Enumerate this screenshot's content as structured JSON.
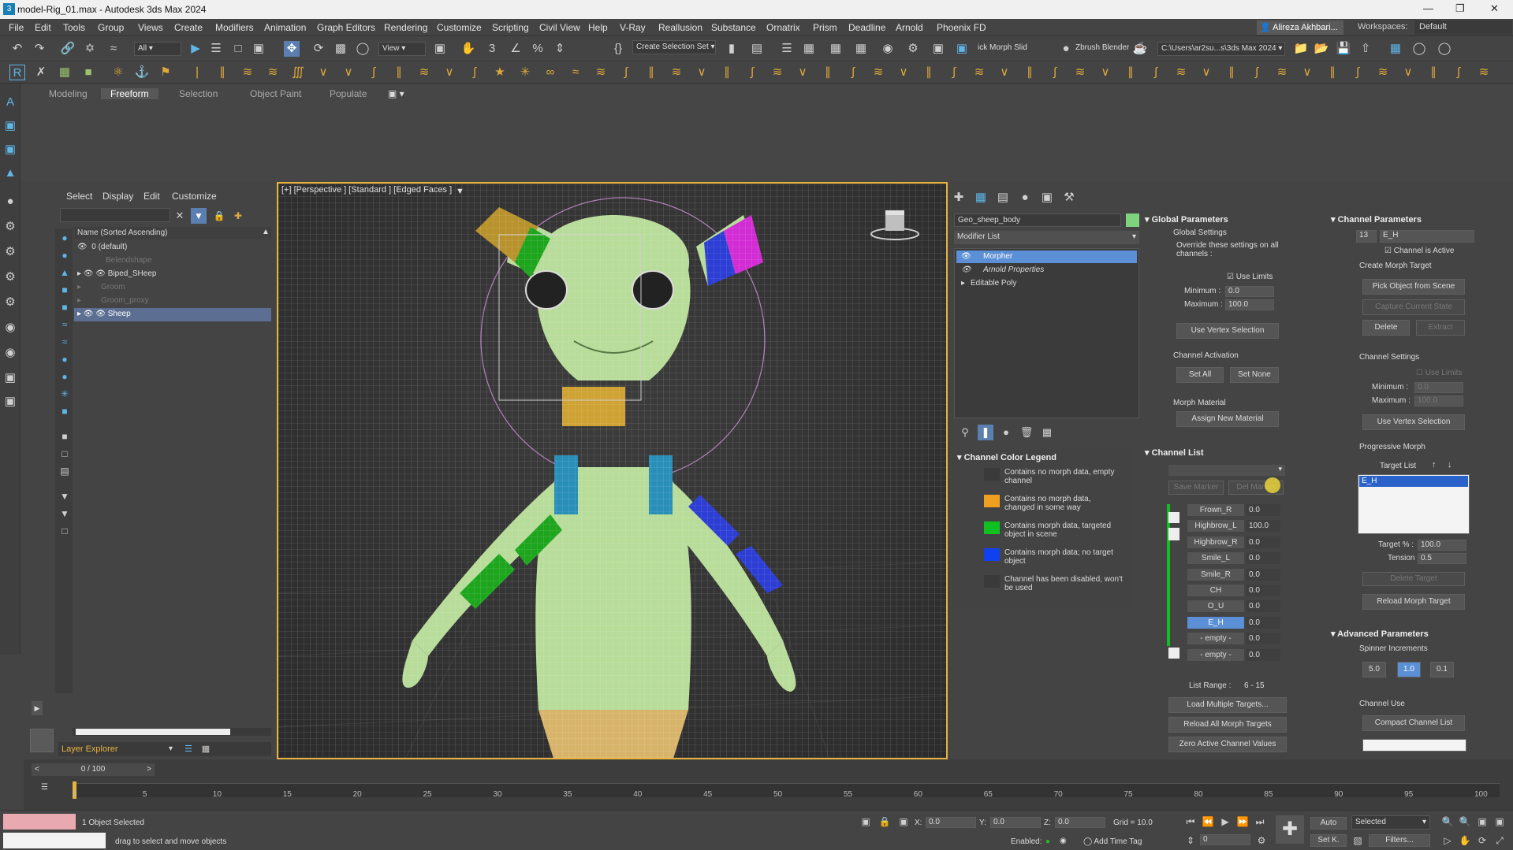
{
  "title": "model-Rig_01.max - Autodesk 3ds Max 2024",
  "menu": [
    "File",
    "Edit",
    "Tools",
    "Group",
    "Views",
    "Create",
    "Modifiers",
    "Animation",
    "Graph Editors",
    "Rendering",
    "Customize",
    "Scripting",
    "Civil View",
    "Help",
    "V-Ray",
    "Reallusion",
    "Substance",
    "Ornatrix",
    "Prism",
    "Deadline",
    "Arnold",
    "Phoenix FD"
  ],
  "user": "Alireza Akhbari...",
  "workspaces_label": "Workspaces:",
  "workspace": "Default",
  "toolbar": {
    "filter": "All",
    "refcoord": "View",
    "selset": "Create Selection Set",
    "morphslider": "ick Morph Slid",
    "zbrush": "Zbrush Blender",
    "path": "C:\\Users\\ar2su...s\\3ds Max 2024"
  },
  "ribbon_tabs": [
    "Modeling",
    "Freeform",
    "Selection",
    "Object Paint",
    "Populate"
  ],
  "scene": {
    "menu": [
      "Select",
      "Display",
      "Edit",
      "Customize"
    ],
    "header": "Name (Sorted Ascending)",
    "items": [
      "0 (default)",
      "Belendshape",
      "Biped_SHeep",
      "Groom",
      "Groom_proxy",
      "Sheep"
    ],
    "footer": "Layer Explorer"
  },
  "viewport": {
    "label": "[+] [Perspective ] [Standard ] [Edged Faces ]"
  },
  "modify": {
    "object_name": "Geo_sheep_body",
    "modifier_list": "Modifier List",
    "stack": [
      "Morpher",
      "Arnold Properties",
      "Editable Poly"
    ]
  },
  "legend": {
    "title": "Channel Color Legend",
    "items": [
      {
        "color": "#3a3a3a",
        "text": "Contains no morph data, empty channel"
      },
      {
        "color": "#f0a020",
        "text": "Contains no morph data, changed in some way"
      },
      {
        "color": "#10c020",
        "text": "Contains morph data, targeted object in scene"
      },
      {
        "color": "#1040f0",
        "text": "Contains morph data; no target object"
      },
      {
        "color": "#3a3a3a",
        "text": "Channel has been disabled, won't be used"
      }
    ]
  },
  "global": {
    "title": "Global Parameters",
    "settings": "Global Settings",
    "override": "Override these settings on all channels :",
    "use_limits": "Use Limits",
    "min_label": "Minimum :",
    "min": "0.0",
    "max_label": "Maximum :",
    "max": "100.0",
    "vertex_sel": "Use Vertex Selection",
    "activation": "Channel Activation",
    "set_all": "Set All",
    "set_none": "Set None",
    "morph_mat": "Morph Material",
    "assign": "Assign New Material"
  },
  "channels": {
    "title": "Channel List",
    "save_marker": "Save Marker",
    "del_marker": "Del Marker",
    "list": [
      {
        "name": "Frown_R",
        "val": "0.0"
      },
      {
        "name": "Highbrow_L",
        "val": "100.0"
      },
      {
        "name": "Highbrow_R",
        "val": "0.0"
      },
      {
        "name": "Smile_L",
        "val": "0.0"
      },
      {
        "name": "Smile_R",
        "val": "0.0"
      },
      {
        "name": "CH",
        "val": "0.0"
      },
      {
        "name": "O_U",
        "val": "0.0"
      },
      {
        "name": "E_H",
        "val": "0.0"
      },
      {
        "name": "- empty -",
        "val": "0.0"
      },
      {
        "name": "- empty -",
        "val": "0.0"
      }
    ],
    "range_label": "List Range :",
    "range": "6 - 15",
    "load_multi": "Load Multiple Targets...",
    "reload_all": "Reload All Morph Targets",
    "zero": "Zero Active Channel Values"
  },
  "chparams": {
    "title": "Channel Parameters",
    "num": "13",
    "name": "E_H",
    "active": "Channel is Active",
    "create": "Create Morph Target",
    "pick": "Pick Object from Scene",
    "capture": "Capture Current State",
    "delete": "Delete",
    "extract": "Extract",
    "settings": "Channel Settings",
    "use_limits": "Use Limits",
    "min_label": "Minimum :",
    "min": "0.0",
    "max_label": "Maximum :",
    "max": "100.0",
    "vertex_sel": "Use Vertex Selection",
    "progressive": "Progressive Morph",
    "target_list": "Target List",
    "target": "E_H",
    "target_pct_label": "Target % :",
    "target_pct": "100.0",
    "tension_label": "Tension :",
    "tension": "0.5",
    "delete_target": "Delete Target",
    "reload": "Reload Morph Target"
  },
  "advanced": {
    "title": "Advanced Parameters",
    "spinner": "Spinner Increments",
    "inc": [
      "5.0",
      "1.0",
      "0.1"
    ],
    "channel_use": "Channel Use",
    "compact": "Compact Channel List"
  },
  "timeline": {
    "frame": "0 / 100",
    "ticks": [
      "0",
      "5",
      "10",
      "15",
      "20",
      "25",
      "30",
      "35",
      "40",
      "45",
      "50",
      "55",
      "60",
      "65",
      "70",
      "75",
      "80",
      "85",
      "90",
      "95",
      "100"
    ]
  },
  "status": {
    "selected": "1 Object Selected",
    "hint": "drag to select and move objects",
    "x_label": "X:",
    "x": "0.0",
    "y_label": "Y:",
    "y": "0.0",
    "z_label": "Z:",
    "z": "0.0",
    "grid": "Grid = 10.0",
    "enabled": "Enabled:",
    "add_time_tag": "Add Time Tag",
    "auto": "Auto",
    "selected_dd": "Selected",
    "setk": "Set K.",
    "filters": "Filters...",
    "frame": "0"
  }
}
